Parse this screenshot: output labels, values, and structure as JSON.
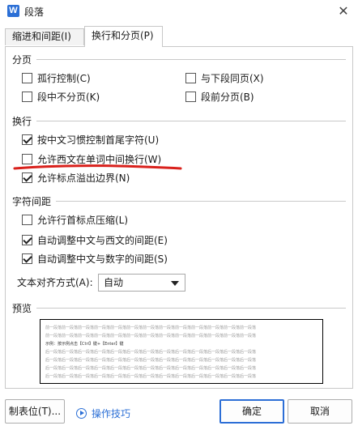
{
  "window": {
    "title": "段落",
    "app_icon_letter": "W",
    "close_glyph": "✕"
  },
  "tabs": [
    {
      "label": "缩进和间距(I)",
      "active": false
    },
    {
      "label": "换行和分页(P)",
      "active": true
    }
  ],
  "pagination": {
    "title": "分页",
    "widow_control": {
      "label": "孤行控制(C)",
      "checked": false
    },
    "keep_with_next": {
      "label": "与下段同页(X)",
      "checked": false
    },
    "keep_lines_together": {
      "label": "段中不分页(K)",
      "checked": false
    },
    "page_break_before": {
      "label": "段前分页(B)",
      "checked": false
    }
  },
  "line_break": {
    "title": "换行",
    "kinsoku": {
      "label": "按中文习惯控制首尾字符(U)",
      "checked": true
    },
    "word_wrap": {
      "label": "允许西文在单词中间换行(W)",
      "checked": false
    },
    "hanging_punct": {
      "label": "允许标点溢出边界(N)",
      "checked": true
    }
  },
  "char_spacing": {
    "title": "字符间距",
    "compress_punct": {
      "label": "允许行首标点压缩(L)",
      "checked": false
    },
    "auto_space_ea_latin": {
      "label": "自动调整中文与西文的间距(E)",
      "checked": true
    },
    "auto_space_ea_digit": {
      "label": "自动调整中文与数字的间距(S)",
      "checked": true
    },
    "text_align": {
      "label": "文本对齐方式(A):",
      "value": "自动"
    }
  },
  "preview": {
    "title": "预览",
    "prev_text": "前一段落前一段落前一段落前一段落前一段落前一段落前一段落前一段落前一段落前一段落前一段落前一段落前一段落",
    "sample_text": "示例：按示例点击【Ctrl】键+【Enter】键",
    "next_text": "后一段落后一段落后一段落后一段落后一段落后一段落后一段落后一段落后一段落后一段落后一段落后一段落后一段落"
  },
  "footer": {
    "tab_stops_label": "制表位(T)...",
    "tips_label": "操作技巧",
    "ok_label": "确定",
    "cancel_label": "取消"
  },
  "colors": {
    "accent": "#2b6fd6",
    "annotation_red": "#d9211c"
  }
}
